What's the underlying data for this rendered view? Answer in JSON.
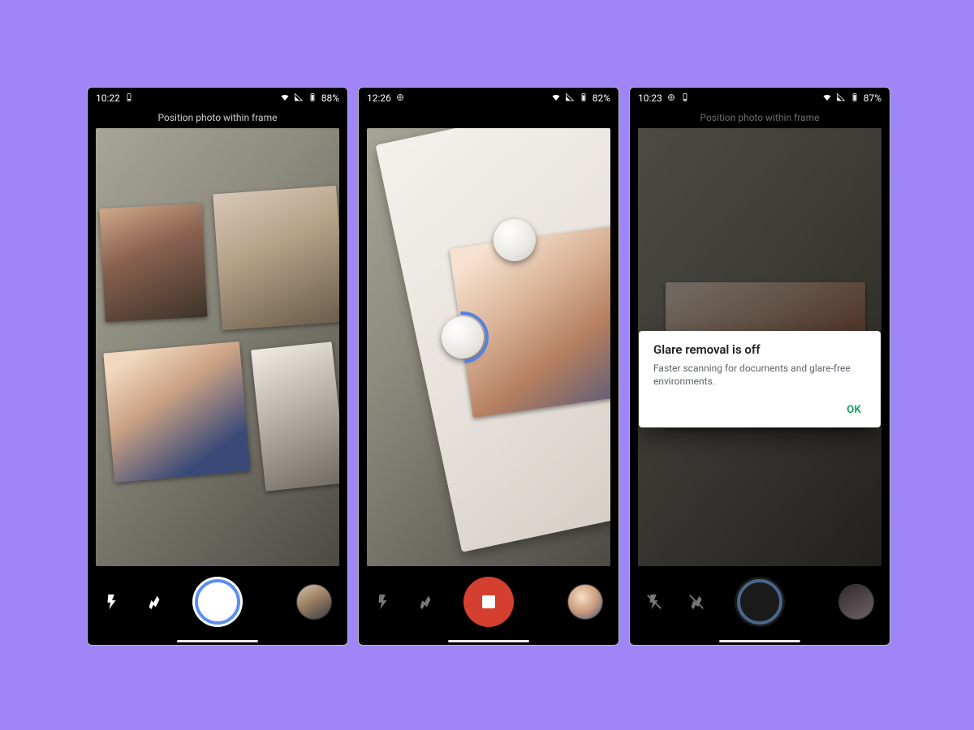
{
  "phones": [
    {
      "status": {
        "time": "10:22",
        "battery": "88%"
      },
      "hint": "Position photo within frame",
      "shutter_mode": "capture",
      "tools_enabled": true,
      "thumb": "multi",
      "dialog": null
    },
    {
      "status": {
        "time": "12:26",
        "battery": "82%"
      },
      "hint": "",
      "shutter_mode": "stop",
      "tools_enabled": false,
      "thumb": "baby",
      "dialog": null
    },
    {
      "status": {
        "time": "10:23",
        "battery": "87%"
      },
      "hint": "Position photo within frame",
      "shutter_mode": "capture-dim",
      "tools_enabled": false,
      "thumb": "dark",
      "dialog": {
        "title": "Glare removal is off",
        "body": "Faster scanning for documents and glare-free environments.",
        "ok": "OK"
      }
    }
  ]
}
